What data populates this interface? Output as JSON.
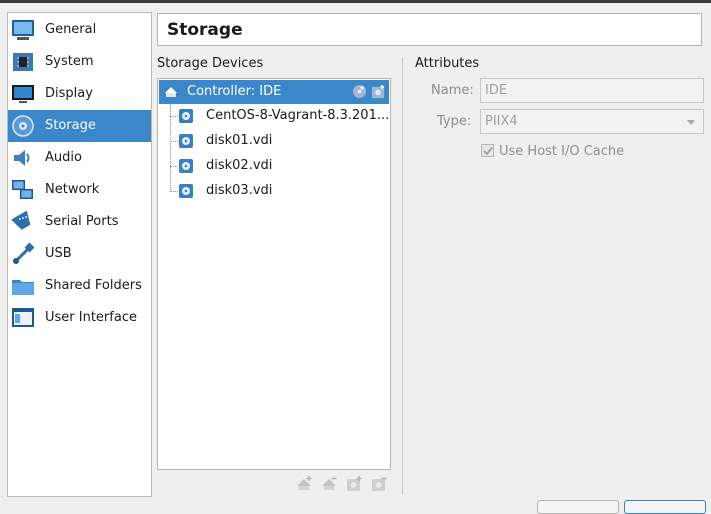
{
  "sidebar": {
    "items": [
      {
        "label": "General",
        "icon": "monitor-general-icon"
      },
      {
        "label": "System",
        "icon": "chip-icon"
      },
      {
        "label": "Display",
        "icon": "display-icon"
      },
      {
        "label": "Storage",
        "icon": "disk-icon",
        "selected": true
      },
      {
        "label": "Audio",
        "icon": "speaker-icon"
      },
      {
        "label": "Network",
        "icon": "network-icon"
      },
      {
        "label": "Serial Ports",
        "icon": "serial-port-icon"
      },
      {
        "label": "USB",
        "icon": "usb-icon"
      },
      {
        "label": "Shared Folders",
        "icon": "folder-icon"
      },
      {
        "label": "User Interface",
        "icon": "window-icon"
      }
    ]
  },
  "page": {
    "title": "Storage"
  },
  "storage": {
    "devices_label": "Storage Devices",
    "controller": {
      "label": "Controller: IDE"
    },
    "disks": [
      {
        "label": "CentOS-8-Vagrant-8.3.201..."
      },
      {
        "label": "disk01.vdi"
      },
      {
        "label": "disk02.vdi"
      },
      {
        "label": "disk03.vdi"
      }
    ]
  },
  "attributes": {
    "section_label": "Attributes",
    "name_label": "Name:",
    "name_value": "IDE",
    "type_label": "Type:",
    "type_value": "PIIX4",
    "cache_label": "Use Host I/O Cache",
    "cache_checked": true
  },
  "colors": {
    "selection": "#3a88c9",
    "accent": "#3c7fc7"
  }
}
